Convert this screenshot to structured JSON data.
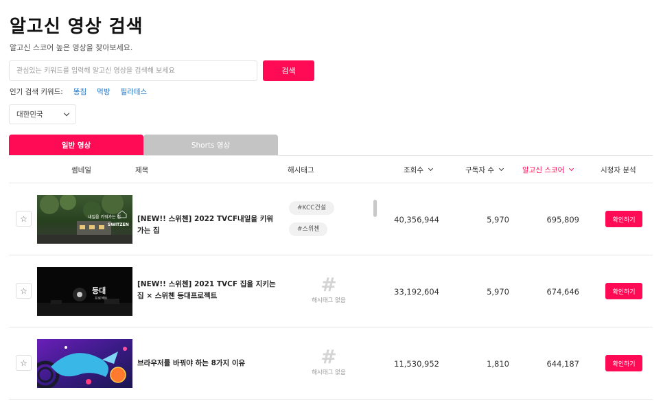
{
  "header": {
    "title": "알고신 영상 검색",
    "subtitle": "알고신 스코어 높은 영상을 찾아보세요."
  },
  "search": {
    "placeholder": "관심있는 키워드를 입력해 알고신 영상을 검색해 보세요",
    "button_label": "검색"
  },
  "popular": {
    "label": "인기 검색 키워드:",
    "keywords": [
      "똥침",
      "먹방",
      "필라테스"
    ]
  },
  "country": {
    "selected": "대한민국"
  },
  "tabs": [
    {
      "label": "일반 영상",
      "active": true
    },
    {
      "label": "Shorts 영상",
      "active": false
    }
  ],
  "table": {
    "columns": {
      "thumbnail": "썸네일",
      "title": "제목",
      "hashtag": "해시태그",
      "views": "조회수",
      "subscribers": "구독자 수",
      "score": "알고신 스코어",
      "analysis": "시청자 분석"
    },
    "no_hashtag_label": "해시태그 없음",
    "confirm_label": "확인하기",
    "rows": [
      {
        "title": "[NEW!! 스위첸] 2022 TVCF내일을 키워 가는 집",
        "hashtags": [
          "#KCC건설",
          "#스위첸"
        ],
        "views": "40,356,944",
        "subscribers": "5,970",
        "score": "695,809",
        "thumb_text_1": "내일을 키워가는 집",
        "thumb_text_2": "SWITZEN"
      },
      {
        "title": "[NEW!! 스위첸] 2021 TVCF 집을 지키는 집 × 스위첸 등대프로젝트",
        "hashtags": [],
        "views": "33,192,604",
        "subscribers": "5,970",
        "score": "674,646",
        "thumb_text_1": "등대",
        "thumb_text_2": "프로젝트"
      },
      {
        "title": "브라우저를 바꿔야 하는 8가지 이유",
        "hashtags": [],
        "views": "11,530,952",
        "subscribers": "1,810",
        "score": "644,187"
      }
    ]
  },
  "colors": {
    "accent": "#ff0a54",
    "link": "#1a73c8",
    "tab_inactive": "#c4c4c4"
  },
  "icons": {
    "star": "star-icon",
    "chevron": "chevron-down-icon",
    "hash": "hash-icon"
  }
}
